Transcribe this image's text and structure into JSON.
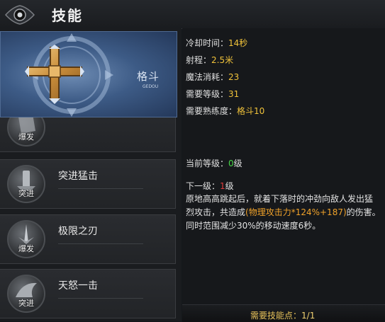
{
  "header": {
    "title": "技能"
  },
  "selected_skill": {
    "name": "格斗",
    "subtitle": "GEDOU"
  },
  "skills": [
    {
      "name": "",
      "tag": "爆发"
    },
    {
      "name": "突进猛击",
      "tag": "突进"
    },
    {
      "name": "极限之刃",
      "tag": "爆发"
    },
    {
      "name": "天怒一击",
      "tag": "突进"
    }
  ],
  "details": {
    "cooldown": {
      "label": "冷却时间：",
      "value": "14秒"
    },
    "range": {
      "label": "射程：",
      "value": "2.5米"
    },
    "mana": {
      "label": "魔法消耗：",
      "value": "23"
    },
    "level_req": {
      "label": "需要等级：",
      "value": "31"
    },
    "mastery_req": {
      "label": "需要熟练度：",
      "value": "格斗10"
    },
    "current_level": {
      "label": "当前等级：",
      "value": "0",
      "unit": "级"
    },
    "next_level": {
      "label": "下一级：",
      "value": "1",
      "unit": "级"
    },
    "description": {
      "line1": "原地高高跳起后，就着下落时的冲劲向敌人发出猛",
      "line2_pre": "烈攻击，共造成",
      "line2_hl": "(物理攻击力*124%+187)",
      "line2_post": "的伤害。",
      "line3": "同时范围减少30%的移动速度6秒。"
    }
  },
  "footer": {
    "label": "需要技能点：",
    "value": "1/1"
  },
  "colors": {
    "value": "#f0c23a",
    "green": "#48d848",
    "red": "#e03a3a",
    "orange": "#f0a22a"
  }
}
